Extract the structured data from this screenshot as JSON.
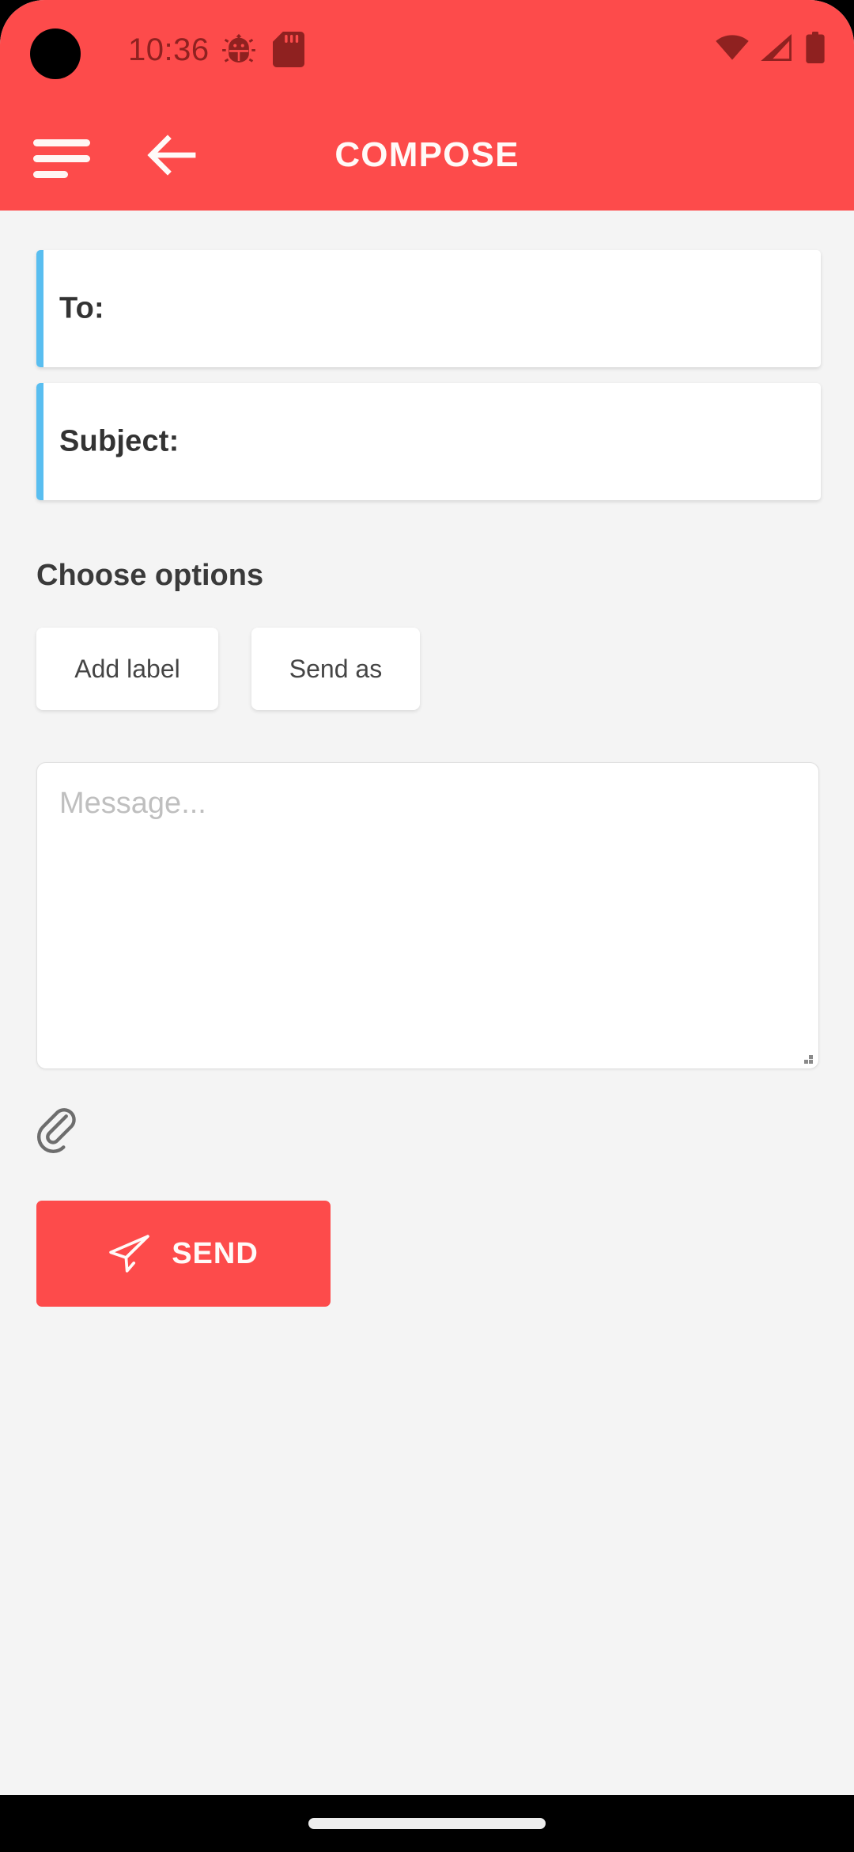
{
  "theme": {
    "accent_red": "#fd4b4b",
    "accent_blue": "#59bef0",
    "page_background": "#f4f4f4",
    "card_background": "#ffffff",
    "status_icon_color": "#8f2120"
  },
  "status_bar": {
    "time": "10:36",
    "icons": [
      "bug-icon",
      "sd-card-icon",
      "wifi-icon",
      "cellular-signal-icon",
      "battery-icon"
    ]
  },
  "app_bar": {
    "title": "COMPOSE",
    "menu_icon": "hamburger-menu-icon",
    "back_icon": "arrow-left-icon"
  },
  "form": {
    "to": {
      "label": "To:",
      "value": "",
      "placeholder": ""
    },
    "subject": {
      "label": "Subject:",
      "value": "",
      "placeholder": ""
    },
    "options": {
      "heading": "Choose options",
      "chips": [
        {
          "label": "Add label"
        },
        {
          "label": "Send as"
        }
      ]
    },
    "message": {
      "value": "",
      "placeholder": "Message..."
    },
    "attachment": {
      "icon": "paperclip-icon"
    },
    "send": {
      "label": "SEND",
      "icon": "paper-plane-icon"
    }
  },
  "navigation_bar": {
    "handle": "gesture-pill"
  }
}
